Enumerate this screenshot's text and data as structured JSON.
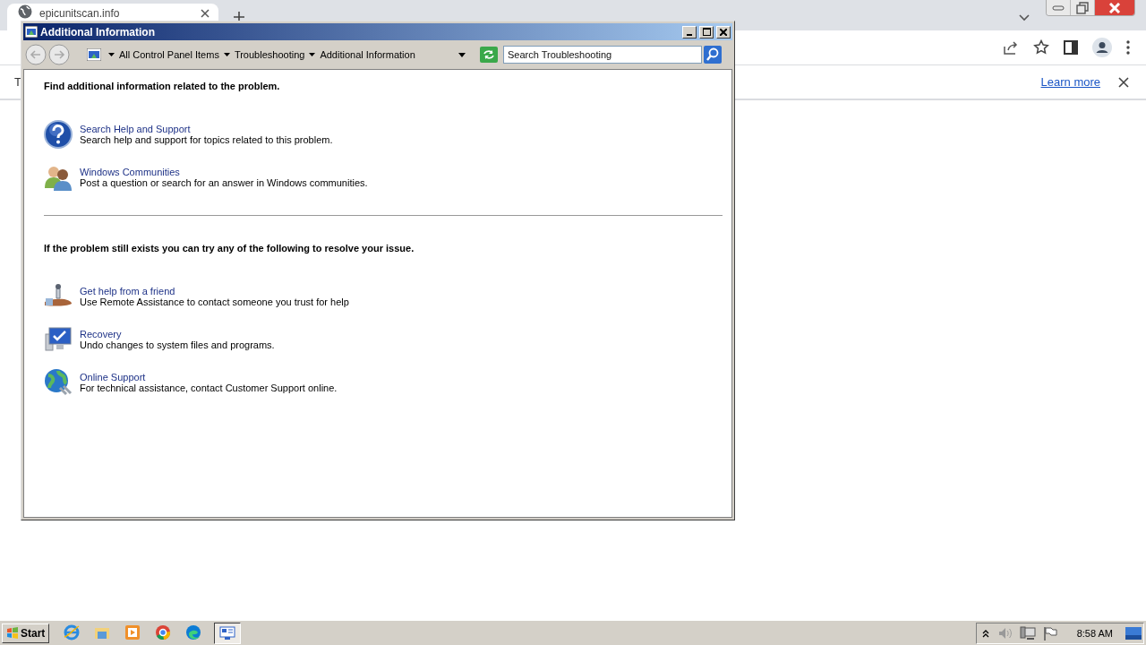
{
  "browser": {
    "tab": {
      "title": "epicunitscan.info"
    },
    "info_bar": {
      "text": "T",
      "link": "Learn more"
    }
  },
  "window": {
    "title": "Additional Information",
    "breadcrumb": [
      "All Control Panel Items",
      "Troubleshooting",
      "Additional Information"
    ],
    "search": {
      "placeholder": "Search Troubleshooting"
    },
    "sections": [
      {
        "heading": "Find additional information related to the problem.",
        "items": [
          {
            "title": "Search Help and Support",
            "description": "Search help and support for topics related to this problem."
          },
          {
            "title": "Windows Communities",
            "description": "Post a question or search for an answer in Windows communities."
          }
        ]
      },
      {
        "heading": "If the problem still exists you can try any of the following to resolve your issue.",
        "items": [
          {
            "title": "Get help from a friend",
            "description": "Use Remote Assistance to contact someone you trust for help"
          },
          {
            "title": "Recovery",
            "description": "Undo changes to system files and programs."
          },
          {
            "title": "Online Support",
            "description": "For technical assistance, contact Customer Support online."
          }
        ]
      }
    ]
  },
  "taskbar": {
    "start": "Start",
    "apps": [
      {
        "selected": false
      },
      {
        "selected": false
      },
      {
        "selected": false
      },
      {
        "selected": false
      },
      {
        "selected": false
      },
      {
        "selected": true
      }
    ],
    "clock": "8:58 AM"
  }
}
